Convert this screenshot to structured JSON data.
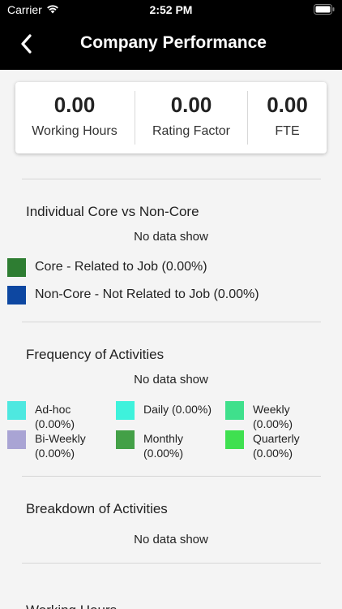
{
  "status_bar": {
    "carrier": "Carrier",
    "time": "2:52 PM"
  },
  "header": {
    "title": "Company Performance"
  },
  "summary": [
    {
      "value": "0.00",
      "label": "Working Hours"
    },
    {
      "value": "0.00",
      "label": "Rating Factor"
    },
    {
      "value": "0.00",
      "label": "FTE"
    }
  ],
  "core": {
    "title": "Individual Core vs Non-Core",
    "empty": "No data show",
    "legend": [
      {
        "label": "Core - Related to Job  (0.00%)",
        "color": "#2e7d32"
      },
      {
        "label": "Non-Core - Not Related to Job  (0.00%)",
        "color": "#0d47a1"
      }
    ]
  },
  "frequency": {
    "title": "Frequency of Activities",
    "empty": "No data show",
    "legend": [
      {
        "label": "Ad-hoc\n(0.00%)",
        "color": "#4ee8e0"
      },
      {
        "label": "Daily  (0.00%)",
        "color": "#3ef2dc"
      },
      {
        "label": "Weekly\n(0.00%)",
        "color": "#3fe08c"
      },
      {
        "label": "Bi-Weekly\n(0.00%)",
        "color": "#a9a4d4"
      },
      {
        "label": "Monthly\n(0.00%)",
        "color": "#43a047"
      },
      {
        "label": "Quarterly\n(0.00%)",
        "color": "#3fe050"
      }
    ]
  },
  "breakdown": {
    "title": "Breakdown of Activities",
    "empty": "No data show"
  },
  "next_section": {
    "title": "Working Hours"
  }
}
